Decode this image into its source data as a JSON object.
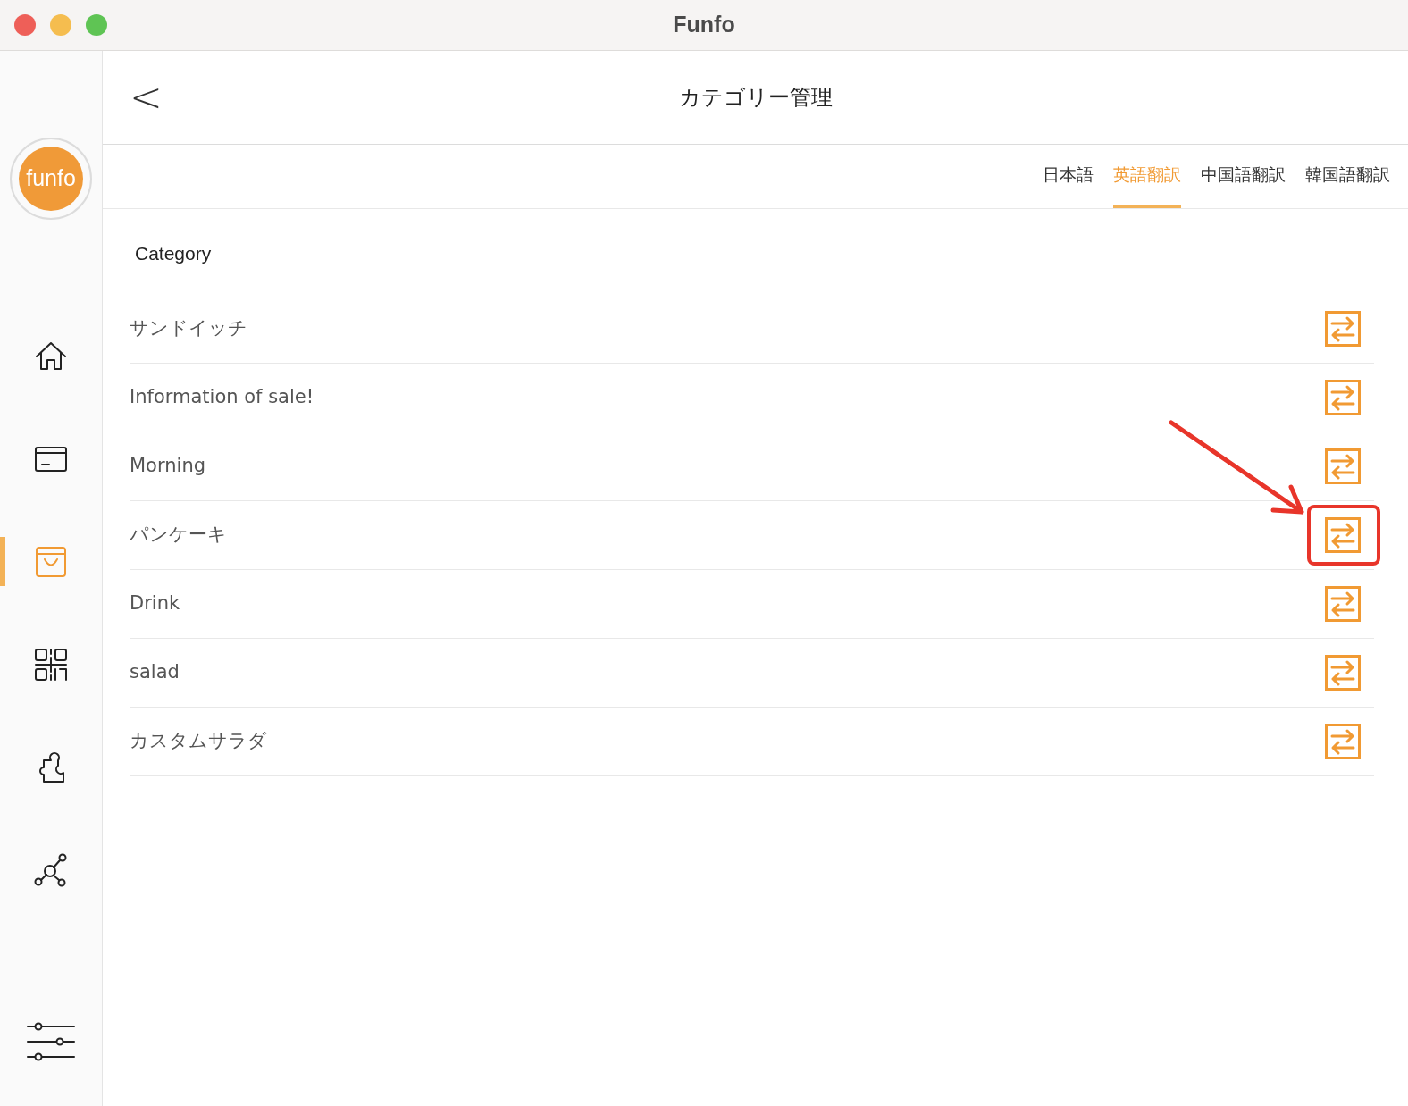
{
  "window": {
    "title": "Funfo"
  },
  "logo": {
    "text": "funfo"
  },
  "sidebar": {
    "items": [
      {
        "kind": "home",
        "selected": false
      },
      {
        "kind": "card",
        "selected": false
      },
      {
        "kind": "bag",
        "selected": true
      },
      {
        "kind": "qr",
        "selected": false
      },
      {
        "kind": "puzzle",
        "selected": false
      },
      {
        "kind": "network",
        "selected": false
      }
    ],
    "bottom": {
      "kind": "sliders",
      "selected": false
    }
  },
  "header": {
    "back": "<",
    "title": "カテゴリー管理"
  },
  "tabs": [
    {
      "label": "日本語",
      "selected": false
    },
    {
      "label": "英語翻訳",
      "selected": true
    },
    {
      "label": "中国語翻訳",
      "selected": false
    },
    {
      "label": "韓国語翻訳",
      "selected": false
    }
  ],
  "section_label": "Category",
  "rows": [
    {
      "name": "サンドイッチ",
      "highlighted": false
    },
    {
      "name": "Information of sale!",
      "highlighted": false
    },
    {
      "name": "Morning",
      "highlighted": false
    },
    {
      "name": "パンケーキ",
      "highlighted": true
    },
    {
      "name": "Drink",
      "highlighted": false
    },
    {
      "name": "salad",
      "highlighted": false
    },
    {
      "name": "カスタムサラダ",
      "highlighted": false
    }
  ]
}
